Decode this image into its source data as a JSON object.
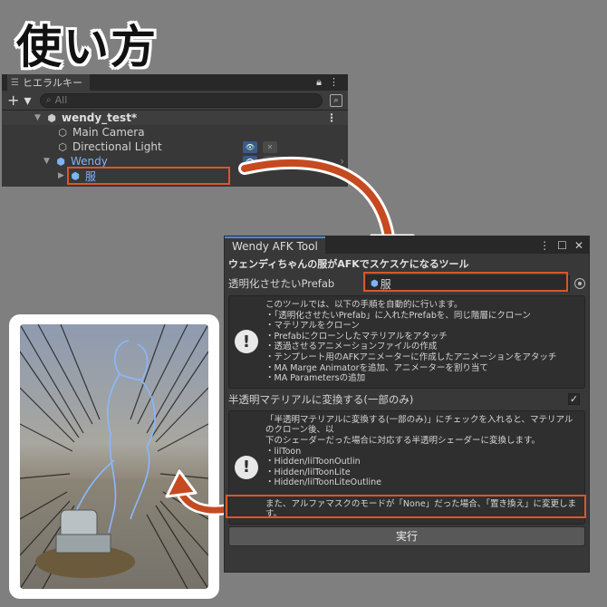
{
  "title": "使い方",
  "hierarchy": {
    "tab_label": "ヒエラルキー",
    "search_placeholder": "All",
    "scene": "wendy_test*",
    "items": [
      {
        "label": "Main Camera"
      },
      {
        "label": "Directional Light"
      },
      {
        "label": "Wendy"
      },
      {
        "label": "服"
      }
    ]
  },
  "afk_tool": {
    "tab_label": "Wendy AFK Tool",
    "heading": "ウェンディちゃんの服がAFKでスケスケになるツール",
    "prefab_label": "透明化させたいPrefab",
    "prefab_value": "服",
    "help1_lines": [
      "このツールでは、以下の手順を自動的に行います。",
      "・「透明化させたいPrefab」に入れたPrefabを、同じ階層にクローン",
      "・マテリアルをクローン",
      "・Prefabにクローンしたマテリアルをアタッチ",
      "・透過させるアニメーションファイルの作成",
      "・テンプレート用のAFKアニメーターに作成したアニメーションをアタッチ",
      "・MA Marge Animatorを追加、アニメーターを割り当て",
      "・MA Parametersの追加"
    ],
    "toggle_label": "半透明マテリアルに変換する(一部のみ)",
    "toggle_checked": true,
    "help2_lines": [
      "「半透明マテリアルに変換する(一部のみ)」にチェックを入れると、マテリアルのクローン後、以",
      "下のシェーダーだった場合に対応する半透明シェーダーに変換します。",
      "・lilToon",
      "・Hidden/lilToonOutlin",
      "・Hidden/lilToonLite",
      "・Hidden/lilToonLiteOutline",
      "",
      "また、アルファマスクのモードが「None」だった場合、「置き換え」に変更します。"
    ],
    "execute_label": "実行"
  },
  "colors": {
    "highlight": "#d9572b",
    "selection_blue": "#7fb3f5"
  }
}
